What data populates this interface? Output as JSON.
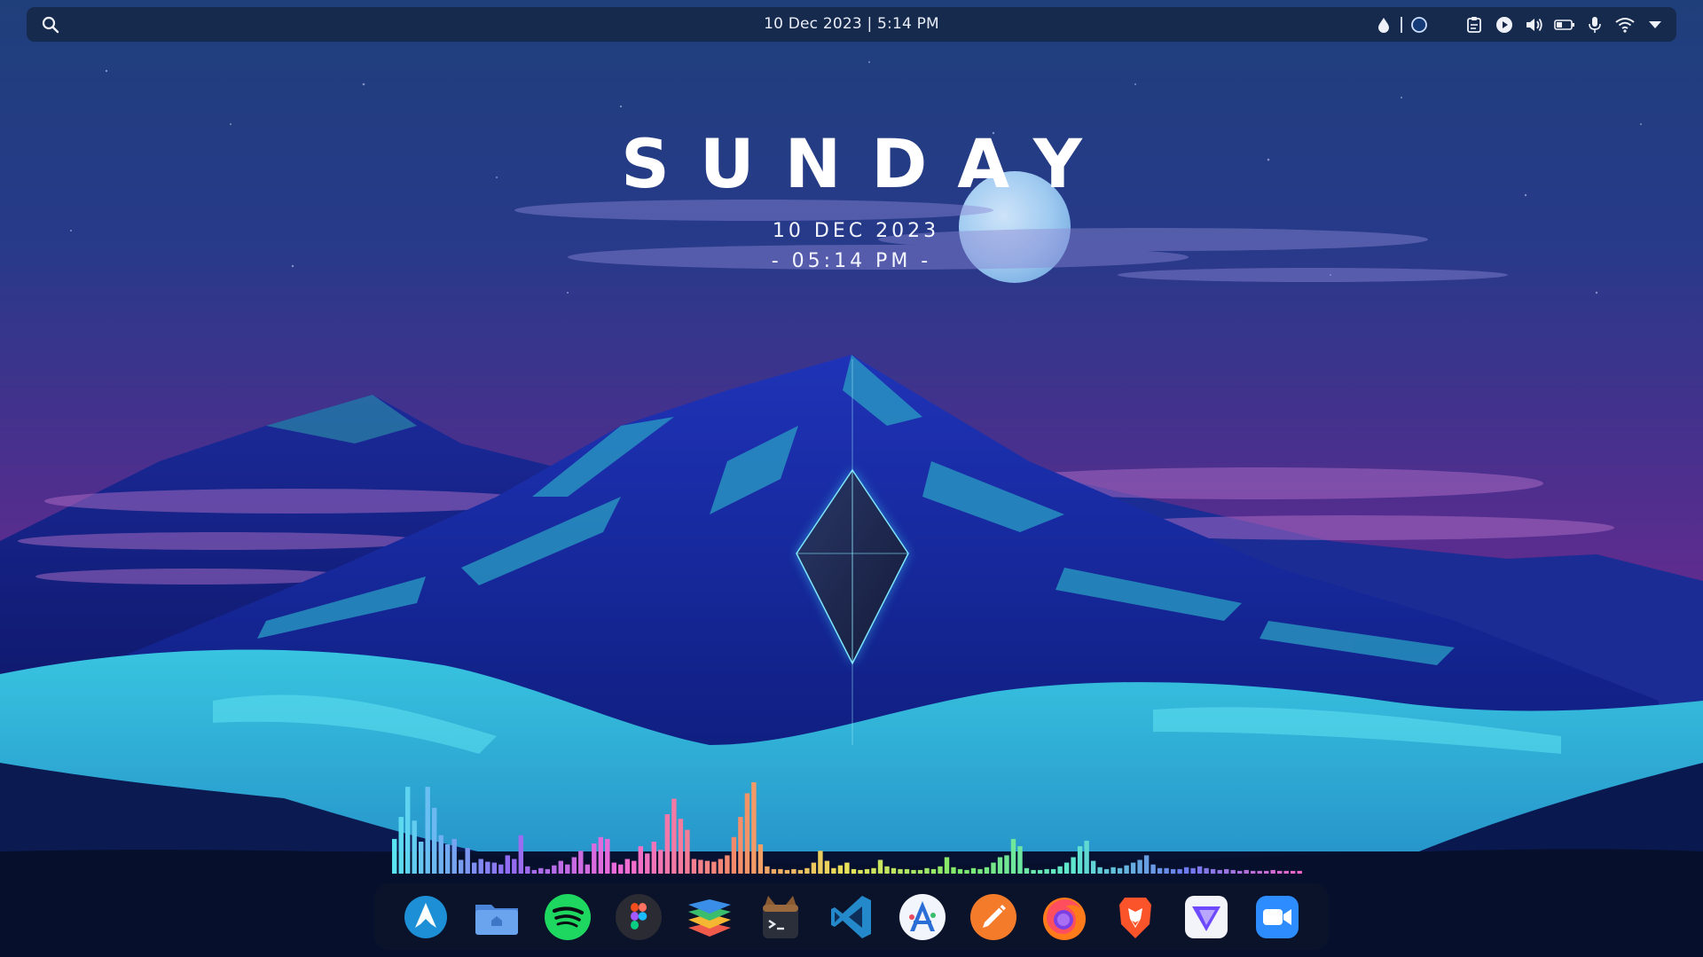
{
  "topbar": {
    "clock": "10 Dec 2023 | 5:14 PM",
    "search_icon": "search-icon",
    "tray_icons": [
      "water-drop-icon",
      "circle-indicator-icon",
      "clipboard-icon",
      "media-play-icon",
      "volume-icon",
      "battery-icon",
      "microphone-icon",
      "wifi-icon",
      "dropdown-arrow-icon"
    ]
  },
  "widget": {
    "day": "SUNDAY",
    "date": "10 DEC 2023",
    "time": "- 05:14 PM -"
  },
  "visualizer": {
    "levels": [
      0.38,
      0.62,
      0.95,
      0.58,
      0.35,
      0.95,
      0.72,
      0.42,
      0.32,
      0.38,
      0.15,
      0.28,
      0.12,
      0.16,
      0.13,
      0.12,
      0.1,
      0.2,
      0.16,
      0.42,
      0.08,
      0.04,
      0.06,
      0.05,
      0.09,
      0.14,
      0.1,
      0.18,
      0.25,
      0.1,
      0.33,
      0.4,
      0.38,
      0.12,
      0.1,
      0.16,
      0.14,
      0.3,
      0.22,
      0.35,
      0.26,
      0.65,
      0.82,
      0.6,
      0.48,
      0.16,
      0.15,
      0.14,
      0.13,
      0.16,
      0.2,
      0.4,
      0.62,
      0.88,
      1.0,
      0.32,
      0.08,
      0.05,
      0.05,
      0.04,
      0.05,
      0.04,
      0.06,
      0.12,
      0.25,
      0.14,
      0.06,
      0.09,
      0.12,
      0.05,
      0.04,
      0.05,
      0.06,
      0.15,
      0.08,
      0.06,
      0.05,
      0.05,
      0.04,
      0.04,
      0.06,
      0.05,
      0.08,
      0.18,
      0.07,
      0.05,
      0.04,
      0.06,
      0.05,
      0.07,
      0.12,
      0.18,
      0.2,
      0.38,
      0.3,
      0.06,
      0.04,
      0.04,
      0.05,
      0.05,
      0.08,
      0.12,
      0.18,
      0.3,
      0.36,
      0.14,
      0.07,
      0.05,
      0.07,
      0.06,
      0.09,
      0.12,
      0.15,
      0.2,
      0.1,
      0.06,
      0.06,
      0.05,
      0.05,
      0.07,
      0.06,
      0.08,
      0.06,
      0.05,
      0.04,
      0.05,
      0.04,
      0.03,
      0.04,
      0.03,
      0.03,
      0.03,
      0.04,
      0.03,
      0.03,
      0.03,
      0.03
    ],
    "colors": [
      "#59e2f0",
      "#8f6cf2",
      "#f06bd8",
      "#f58a6a",
      "#e8e25a",
      "#7ee86c",
      "#5ee6cf",
      "#6d79ee",
      "#f067c8"
    ]
  },
  "dock": {
    "apps": [
      {
        "name": "arch-linux-app",
        "icon": "arch-logo-icon"
      },
      {
        "name": "files-app",
        "icon": "folder-home-icon"
      },
      {
        "name": "spotify-app",
        "icon": "spotify-icon"
      },
      {
        "name": "figma-app",
        "icon": "figma-icon"
      },
      {
        "name": "layers-app",
        "icon": "stacked-layers-icon"
      },
      {
        "name": "terminal-app",
        "icon": "terminal-cat-icon"
      },
      {
        "name": "vscode-app",
        "icon": "vscode-icon"
      },
      {
        "name": "app-store-app",
        "icon": "app-store-icon"
      },
      {
        "name": "pen-app",
        "icon": "pen-icon"
      },
      {
        "name": "firefox-app",
        "icon": "firefox-icon"
      },
      {
        "name": "brave-app",
        "icon": "brave-lion-icon"
      },
      {
        "name": "proton-vpn-app",
        "icon": "vpn-triangle-icon"
      },
      {
        "name": "zoom-app",
        "icon": "video-camera-icon"
      }
    ]
  }
}
